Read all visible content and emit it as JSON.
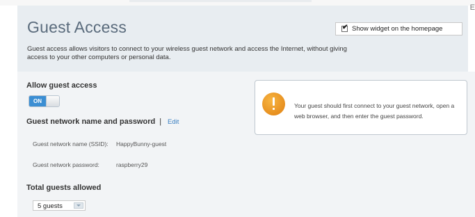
{
  "header": {
    "title": "Guest Access",
    "description": "Guest access allows visitors to connect to your wireless guest network and access the Internet, without giving access to your other computers or personal data.",
    "widget_label": "Show widget on the homepage",
    "widget_checked": true
  },
  "allow_guest": {
    "heading": "Allow guest access",
    "toggle_label": "ON",
    "toggle_state": "on"
  },
  "network": {
    "heading": "Guest network name and password",
    "separator": "|",
    "edit_label": "Edit",
    "ssid_label": "Guest network name (SSID):",
    "ssid_value": "HappyBunny-guest",
    "password_label": "Guest network password:",
    "password_value": "raspberry29"
  },
  "guests": {
    "heading": "Total guests allowed",
    "selected": "5 guests"
  },
  "info": {
    "icon": "warning-icon",
    "text": "Your guest should first connect to your guest network, open a web browser, and then enter the guest password."
  },
  "edge_letter": "E",
  "colors": {
    "accent": "#3b8ed3",
    "link": "#3a7fc1",
    "header_bg": "#e8edf1",
    "warning": "#e98f1c"
  }
}
